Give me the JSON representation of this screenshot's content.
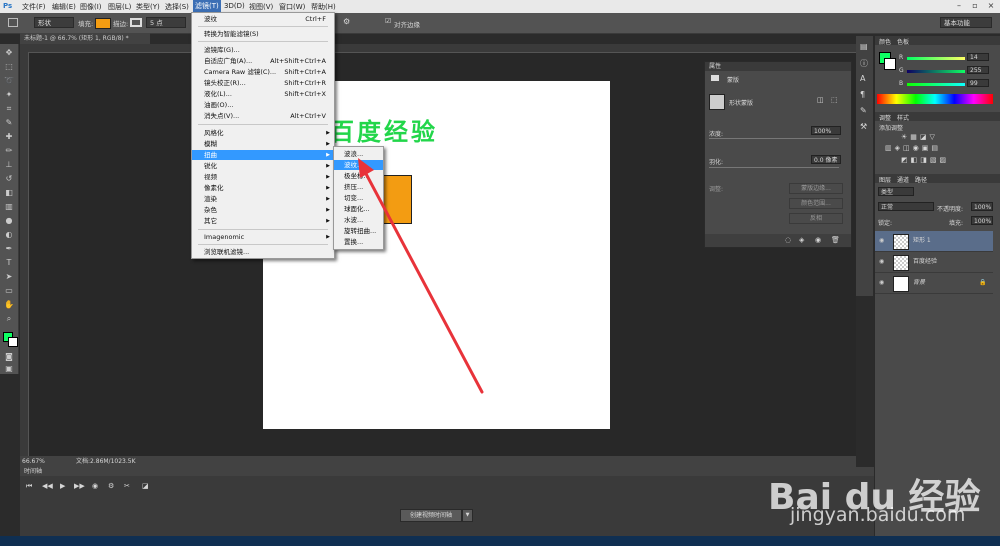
{
  "menubar": {
    "logo": "Ps",
    "items": [
      "文件(F)",
      "编辑(E)",
      "图像(I)",
      "图层(L)",
      "类型(Y)",
      "选择(S)",
      "滤镜(T)",
      "3D(D)",
      "视图(V)",
      "窗口(W)",
      "帮助(H)"
    ],
    "active_index": 6
  },
  "optbar": {
    "shape_mode": "形状",
    "fill_label": "填充:",
    "fill_color": "#f39c12",
    "stroke_label": "描边:",
    "stroke_width": "5 点",
    "align_edges": "对齐边缘",
    "workspace": "基本功能"
  },
  "document": {
    "tab_title": "未标题-1 @ 66.7% (矩形 1, RGB/8) *",
    "canvas_text": "百度经验",
    "zoom": "66.67%",
    "doc_size": "文档:2.86M/1023.5K"
  },
  "filter_menu": {
    "items": [
      {
        "label": "波纹",
        "shortcut": "Ctrl+F"
      },
      {
        "label": "转换为智能滤镜(S)",
        "shortcut": ""
      },
      {
        "label": "滤镜库(G)...",
        "shortcut": ""
      },
      {
        "label": "自适应广角(A)...",
        "shortcut": "Alt+Shift+Ctrl+A"
      },
      {
        "label": "Camera Raw 滤镜(C)...",
        "shortcut": "Shift+Ctrl+A"
      },
      {
        "label": "镜头校正(R)...",
        "shortcut": "Shift+Ctrl+R"
      },
      {
        "label": "液化(L)...",
        "shortcut": "Shift+Ctrl+X"
      },
      {
        "label": "油画(O)...",
        "shortcut": ""
      },
      {
        "label": "消失点(V)...",
        "shortcut": "Alt+Ctrl+V"
      },
      {
        "label": "风格化",
        "shortcut": ""
      },
      {
        "label": "模糊",
        "shortcut": ""
      },
      {
        "label": "扭曲",
        "shortcut": ""
      },
      {
        "label": "锐化",
        "shortcut": ""
      },
      {
        "label": "视频",
        "shortcut": ""
      },
      {
        "label": "像素化",
        "shortcut": ""
      },
      {
        "label": "渲染",
        "shortcut": ""
      },
      {
        "label": "杂色",
        "shortcut": ""
      },
      {
        "label": "其它",
        "shortcut": ""
      },
      {
        "label": "Imagenomic",
        "shortcut": ""
      },
      {
        "label": "浏览联机滤镜...",
        "shortcut": ""
      }
    ]
  },
  "distort_submenu": {
    "items": [
      "波浪...",
      "波纹...",
      "极坐标...",
      "挤压...",
      "切变...",
      "球面化...",
      "水波...",
      "旋转扭曲...",
      "置换..."
    ]
  },
  "properties_panel": {
    "title": "属性",
    "mask_label": "蒙版",
    "vector_mask": "形状蒙版",
    "density_label": "浓度:",
    "density_value": "100%",
    "feather_label": "羽化:",
    "feather_value": "0.0 像素",
    "refine_label": "调整:",
    "buttons": [
      "蒙版边缘...",
      "颜色范围...",
      "反相"
    ]
  },
  "color_panel": {
    "tabs": [
      "颜色",
      "色板"
    ],
    "r": "14",
    "g": "255",
    "b": "99",
    "r_label": "R",
    "g_label": "G",
    "b_label": "B"
  },
  "adjust_panel": {
    "tabs": [
      "调整",
      "样式"
    ],
    "add_label": "添加调整"
  },
  "layers_panel": {
    "tabs": [
      "图层",
      "通道",
      "路径"
    ],
    "kind": "类型",
    "blend": "正常",
    "opacity_label": "不透明度:",
    "opacity": "100%",
    "lock_label": "锁定:",
    "fill_label": "填充:",
    "fill": "100%",
    "layers": [
      {
        "name": "矩形 1",
        "selected": true
      },
      {
        "name": "百度经验",
        "selected": false
      },
      {
        "name": "背景",
        "selected": false
      }
    ]
  },
  "timeline": {
    "title": "时间轴",
    "create_button": "创建视频时间轴"
  },
  "watermark": {
    "logo": "Bai du 经验",
    "url": "jingyan.baidu.com"
  }
}
